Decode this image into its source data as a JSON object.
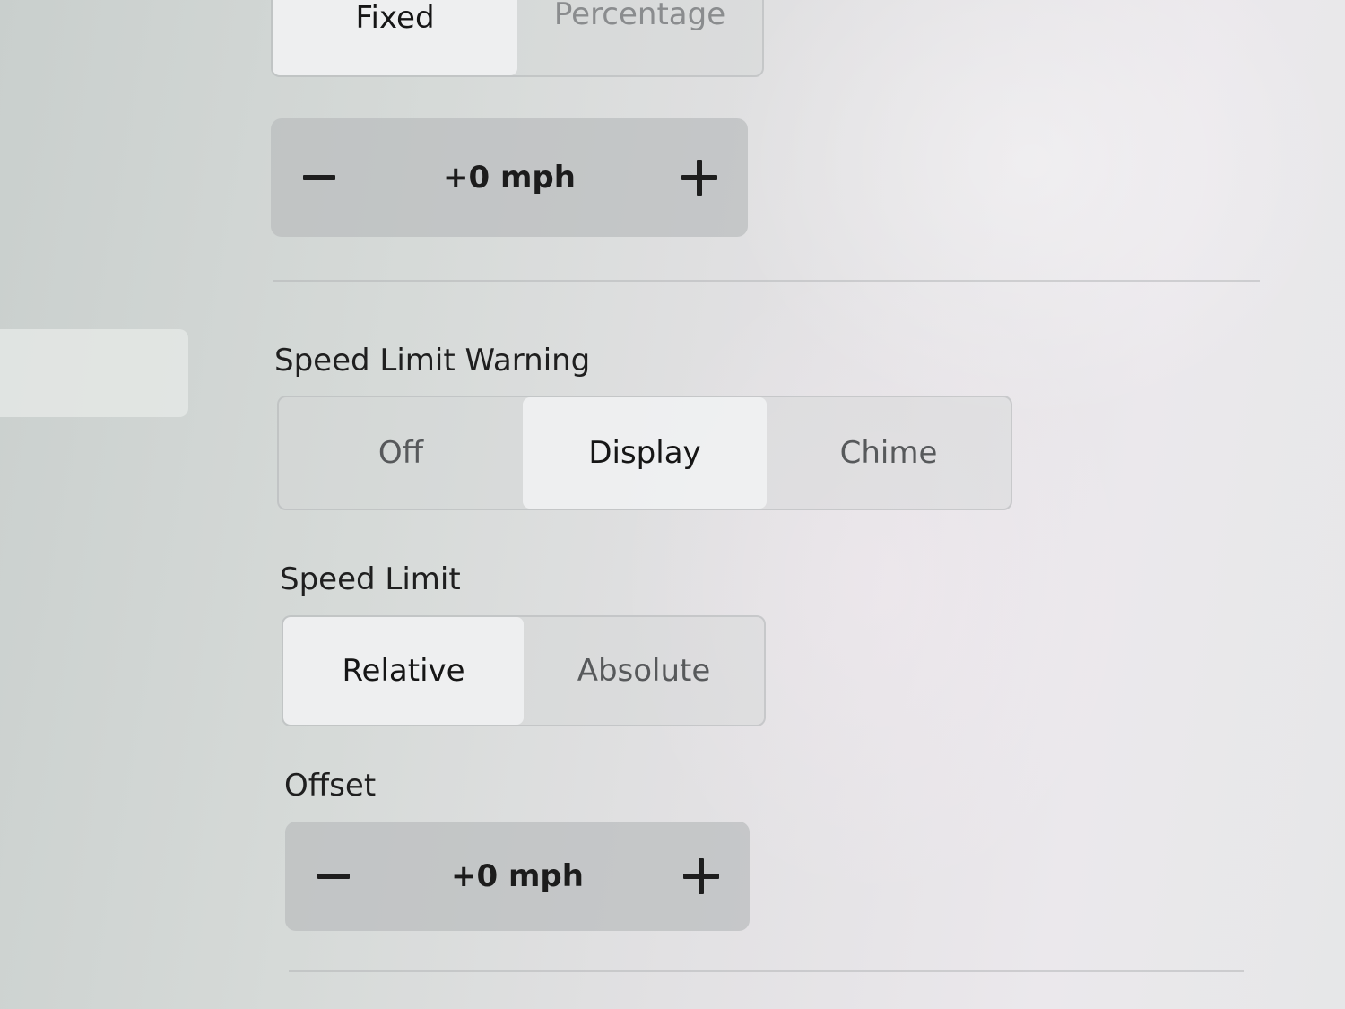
{
  "sidebar": {
    "selected_item": ""
  },
  "offset_type": {
    "options": [
      "Fixed",
      "Percentage"
    ],
    "selected": "Fixed"
  },
  "fixed_offset_stepper": {
    "value": "+0 mph",
    "decrement_icon": "minus-icon",
    "increment_icon": "plus-icon"
  },
  "speed_limit_warning": {
    "label": "Speed Limit Warning",
    "options": [
      "Off",
      "Display",
      "Chime"
    ],
    "selected": "Display"
  },
  "speed_limit": {
    "label": "Speed Limit",
    "options": [
      "Relative",
      "Absolute"
    ],
    "selected": "Relative"
  },
  "offset": {
    "label": "Offset",
    "value": "+0 mph",
    "decrement_icon": "minus-icon",
    "increment_icon": "plus-icon"
  }
}
